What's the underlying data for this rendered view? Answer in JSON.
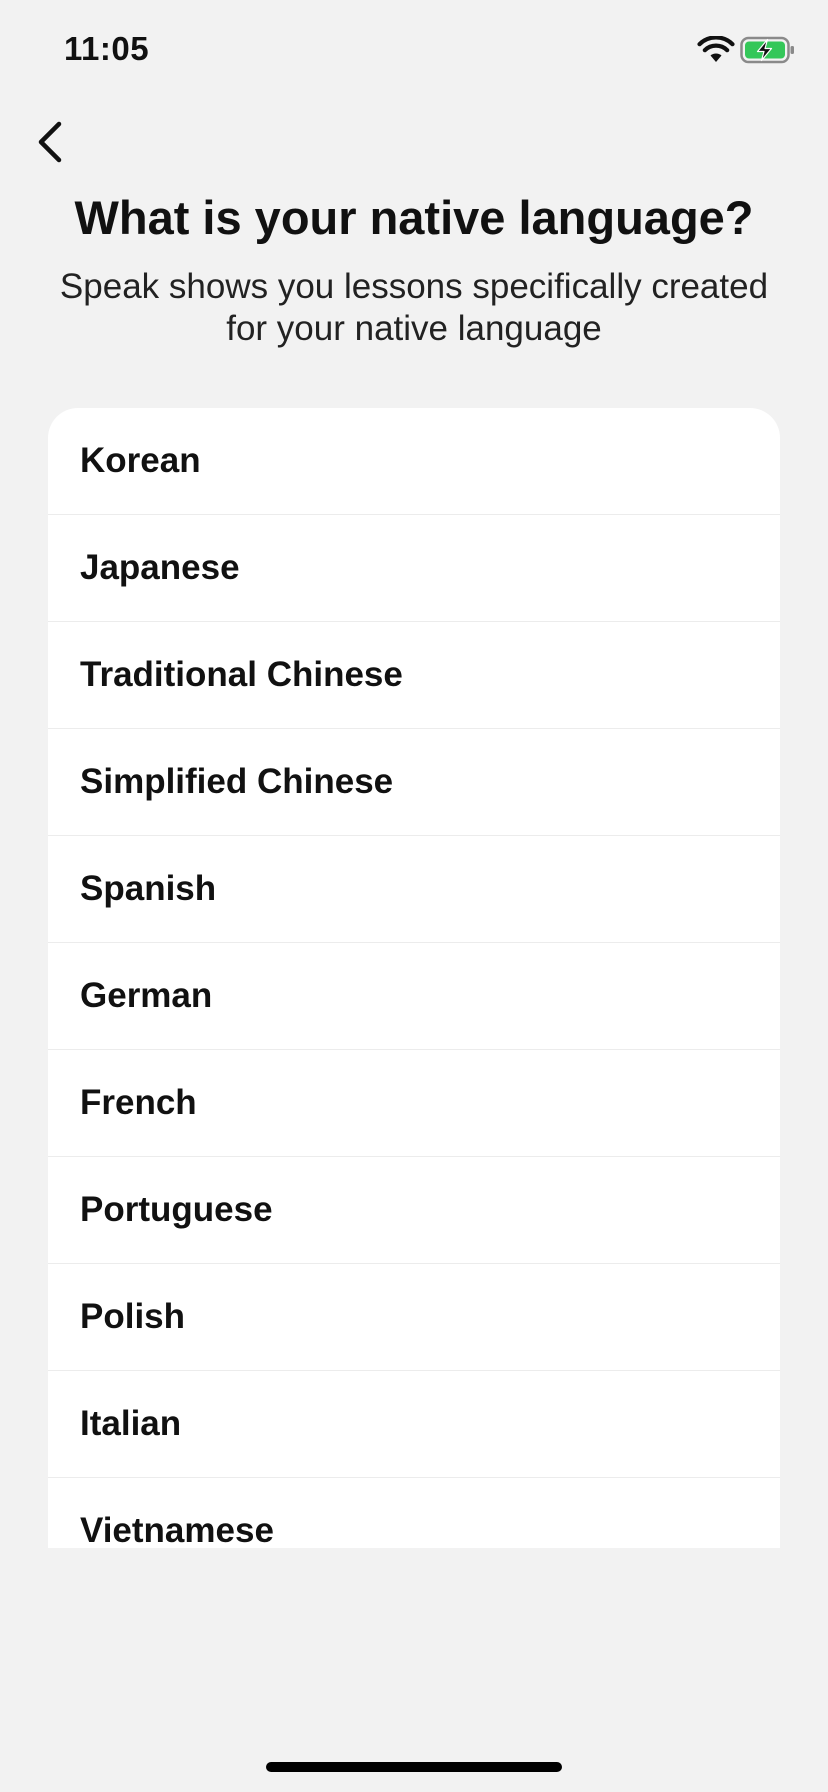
{
  "status_bar": {
    "time": "11:05"
  },
  "header": {
    "title": "What is your native language?",
    "subtitle": "Speak shows you lessons specifically created for your native language"
  },
  "languages": [
    {
      "label": "Korean"
    },
    {
      "label": "Japanese"
    },
    {
      "label": "Traditional Chinese"
    },
    {
      "label": "Simplified Chinese"
    },
    {
      "label": "Spanish"
    },
    {
      "label": "German"
    },
    {
      "label": "French"
    },
    {
      "label": "Portuguese"
    },
    {
      "label": "Polish"
    },
    {
      "label": "Italian"
    },
    {
      "label": "Vietnamese"
    }
  ],
  "icons": {
    "back": "chevron-left-icon",
    "wifi": "wifi-icon",
    "battery": "battery-charging-icon"
  },
  "colors": {
    "background": "#f2f2f2",
    "card": "#ffffff",
    "battery_fill": "#34c759"
  }
}
